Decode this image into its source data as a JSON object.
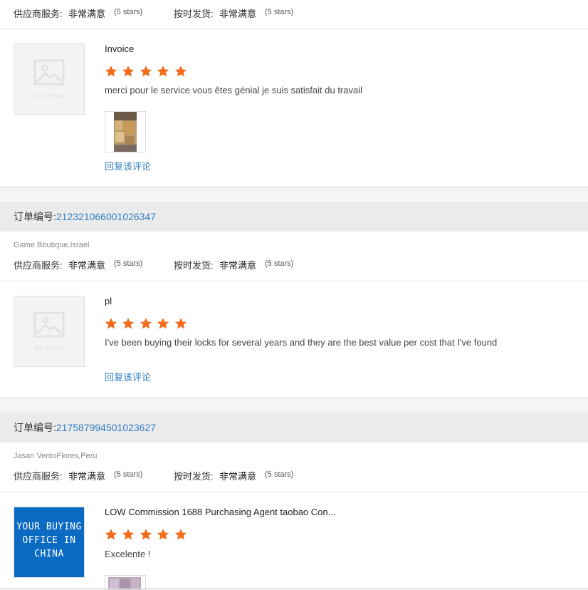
{
  "labels": {
    "order_prefix": "订单编号:",
    "supplier_service": "供应商服务:",
    "on_time_shipping": "按时发货:",
    "very_satisfied": "非常满意",
    "five_stars": "(5 stars)",
    "reply": "回复该评论",
    "no_photo": "No Photo"
  },
  "colors": {
    "star": "#f26c1b",
    "link": "#2f7dc1",
    "order_bar": "#ebebeb"
  },
  "reviews": [
    {
      "order_number": "",
      "buyer": "",
      "supplier_rating_stars": 5,
      "shipping_rating_stars": 5,
      "product_name": "Invoice",
      "rating_stars": 5,
      "comment": "merci pour le service vous êtes génial  je suis satisfait du travail",
      "has_photo": true
    },
    {
      "order_number": "212321066001026347",
      "buyer": "Game Boutique,Israel",
      "supplier_rating_stars": 5,
      "shipping_rating_stars": 5,
      "product_name": "pl",
      "rating_stars": 5,
      "comment": "I've been buying their locks for several years and they are the best value per cost that I've found",
      "has_photo": false
    },
    {
      "order_number": "217587994501023627",
      "buyer": "Jasan VentoFlores,Peru",
      "supplier_rating_stars": 5,
      "shipping_rating_stars": 5,
      "product_name": "LOW Commission 1688 Purchasing Agent taobao Con...",
      "product_image_text": "YOUR BUYING\nOFFICE IN\nCHINA",
      "rating_stars": 5,
      "comment": "Excelente !",
      "has_photo": true
    }
  ]
}
